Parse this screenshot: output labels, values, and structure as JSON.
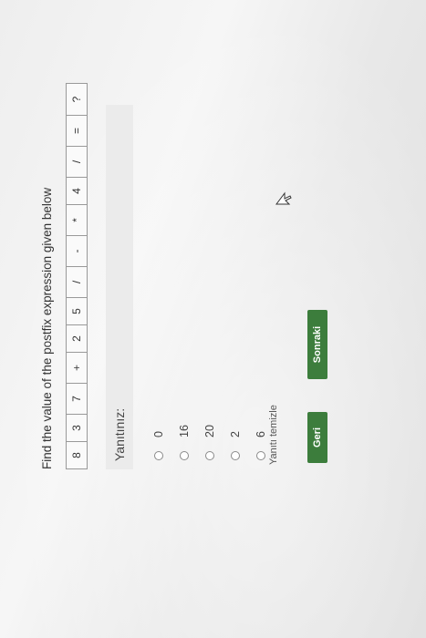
{
  "question": "Find the value of the postfix expression given below",
  "expression": {
    "tokens": [
      "8",
      "3",
      "7",
      "+",
      "2",
      "5",
      "/",
      "-",
      "*",
      "4",
      "/",
      "=",
      "?"
    ]
  },
  "answers_heading": "Yanıtınız:",
  "options": [
    {
      "label": "0"
    },
    {
      "label": "16"
    },
    {
      "label": "20"
    },
    {
      "label": "2"
    },
    {
      "label": "6"
    }
  ],
  "clear_answer": "Yanıtı temizle",
  "buttons": {
    "back": "Geri",
    "next": "Sonraki"
  },
  "colors": {
    "button_green": "#3c7d3c",
    "answer_bar": "#ebebeb"
  },
  "cursor_icon": "mouse-pointer-icon"
}
